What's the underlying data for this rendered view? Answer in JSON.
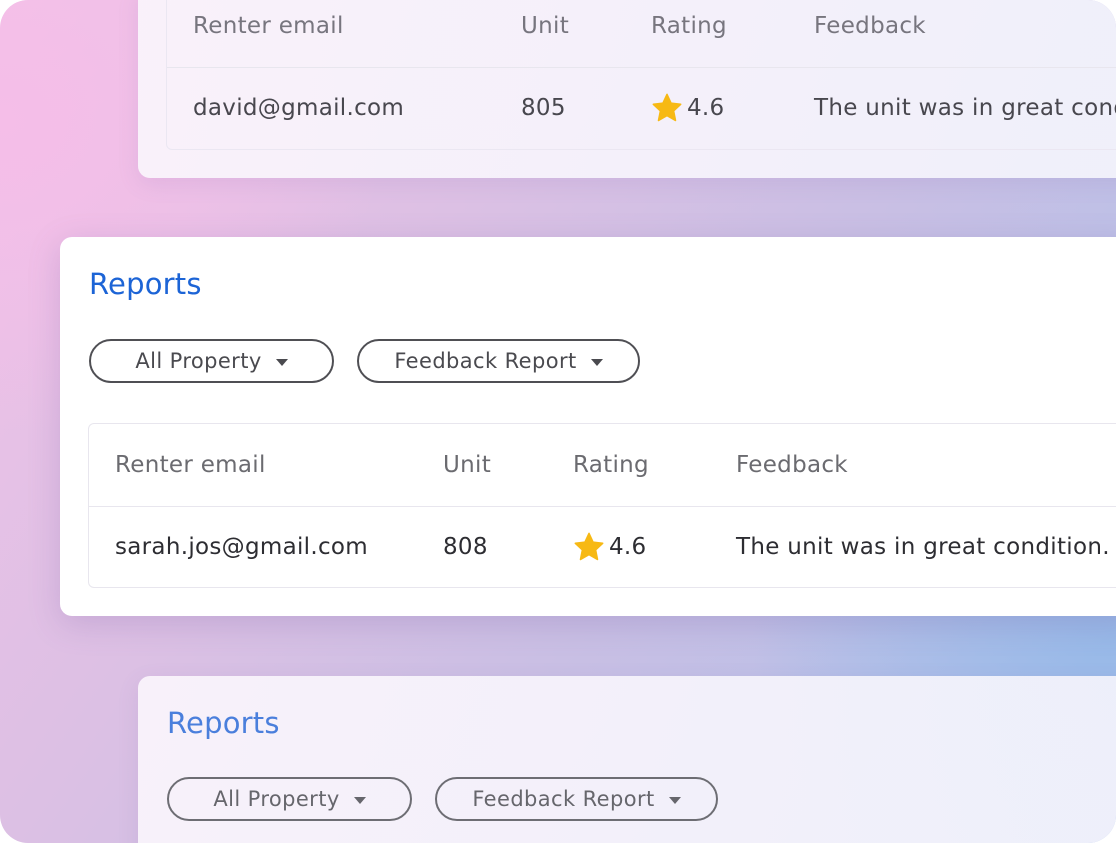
{
  "reports_title": "Reports",
  "filters": {
    "property": "All Property",
    "report_type": "Feedback Report"
  },
  "table": {
    "headers": {
      "email": "Renter email",
      "unit": "Unit",
      "rating": "Rating",
      "feedback": "Feedback"
    }
  },
  "top_row": {
    "email": "david@gmail.com",
    "unit": "805",
    "rating": "4.6",
    "feedback": "The unit was in great condition."
  },
  "main_row": {
    "email": "sarah.jos@gmail.com",
    "unit": "808",
    "rating": "4.6",
    "feedback": "The unit was in great condition."
  },
  "colors": {
    "title_blue": "#1c64d6",
    "star_gold": "#f7b914"
  },
  "icons": {
    "rating": "star-icon",
    "dropdown": "caret-down-icon"
  }
}
